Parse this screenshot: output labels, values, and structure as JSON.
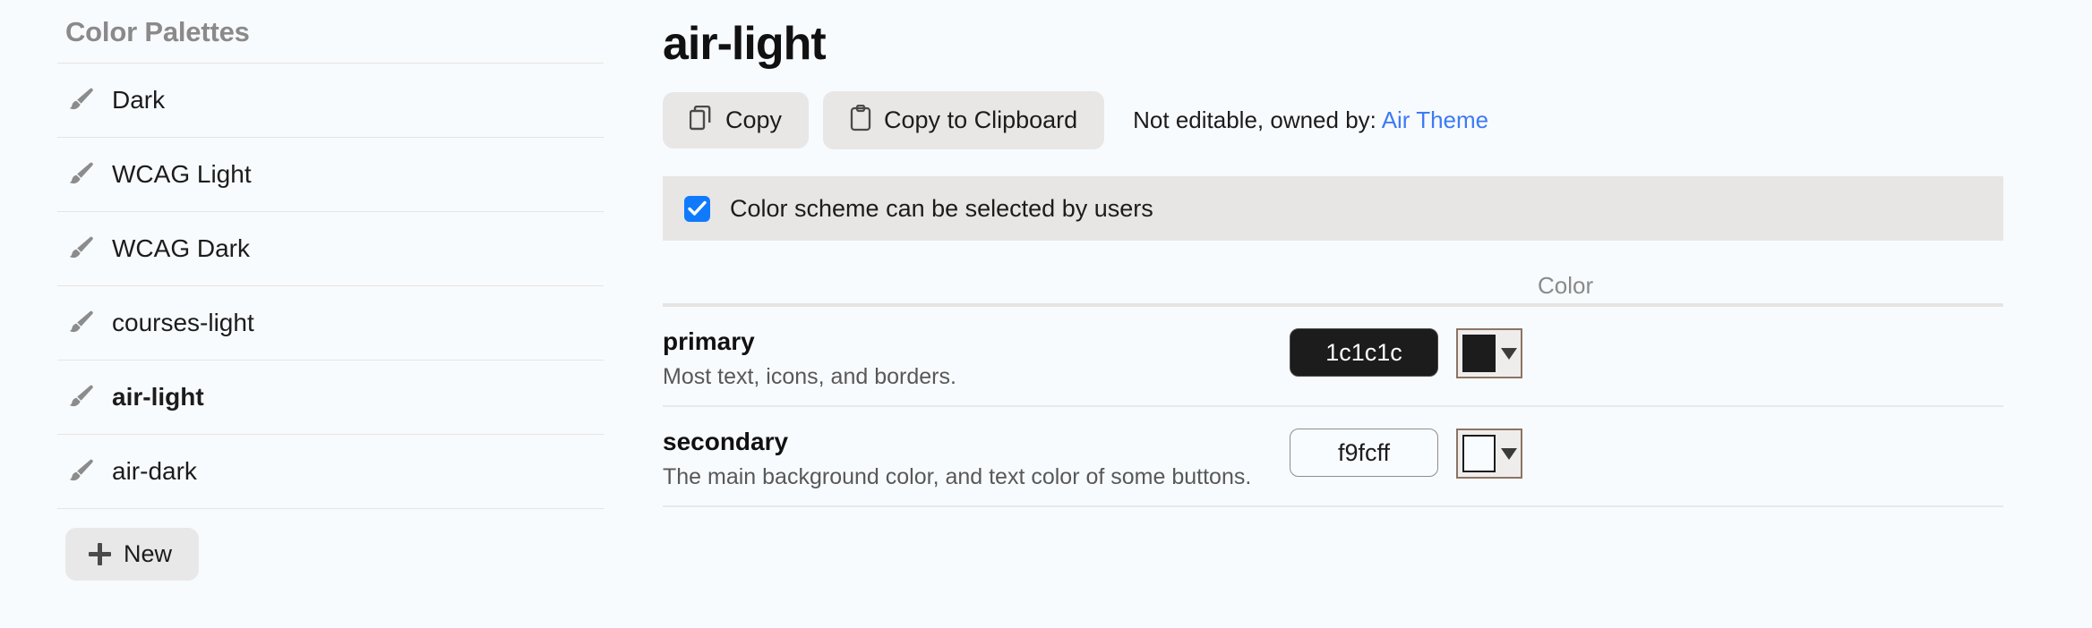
{
  "sidebar": {
    "title": "Color Palettes",
    "items": [
      {
        "label": "Dark",
        "icon": "paintbrush-icon",
        "selected": false
      },
      {
        "label": "WCAG Light",
        "icon": "paintbrush-icon",
        "selected": false
      },
      {
        "label": "WCAG Dark",
        "icon": "paintbrush-icon",
        "selected": false
      },
      {
        "label": "courses-light",
        "icon": "paintbrush-icon",
        "selected": false
      },
      {
        "label": "air-light",
        "icon": "paintbrush-icon",
        "selected": true
      },
      {
        "label": "air-dark",
        "icon": "paintbrush-icon",
        "selected": false
      }
    ],
    "new_button": {
      "label": "New",
      "icon": "plus-icon"
    }
  },
  "main": {
    "title": "air-light",
    "toolbar": {
      "copy_label": "Copy",
      "copy_icon": "copy-documents-icon",
      "copy_clipboard_label": "Copy to Clipboard",
      "copy_clipboard_icon": "clipboard-icon",
      "owner_note_prefix": "Not editable, owned by: ",
      "owner_link_label": "Air Theme"
    },
    "scheme_checkbox": {
      "label": "Color scheme can be selected by users",
      "checked": true,
      "accent": "#107afd"
    },
    "table": {
      "columns": {
        "name": "",
        "color": "Color"
      },
      "rows": [
        {
          "name": "primary",
          "description": "Most text, icons, and borders.",
          "value": "1c1c1c",
          "swatch_color": "#1c1c1c",
          "input_style": "dark"
        },
        {
          "name": "secondary",
          "description": "The main background color, and text color of some buttons.",
          "value": "f9fcff",
          "swatch_color": "#f9fcff",
          "input_style": "light"
        }
      ]
    }
  },
  "colors": {
    "page_background": "#f8fbfe",
    "bar_background": "#e7e6e5",
    "link": "#3d7bf5",
    "muted_text": "#8a8a8a",
    "swatch_border": "#8c7464"
  }
}
